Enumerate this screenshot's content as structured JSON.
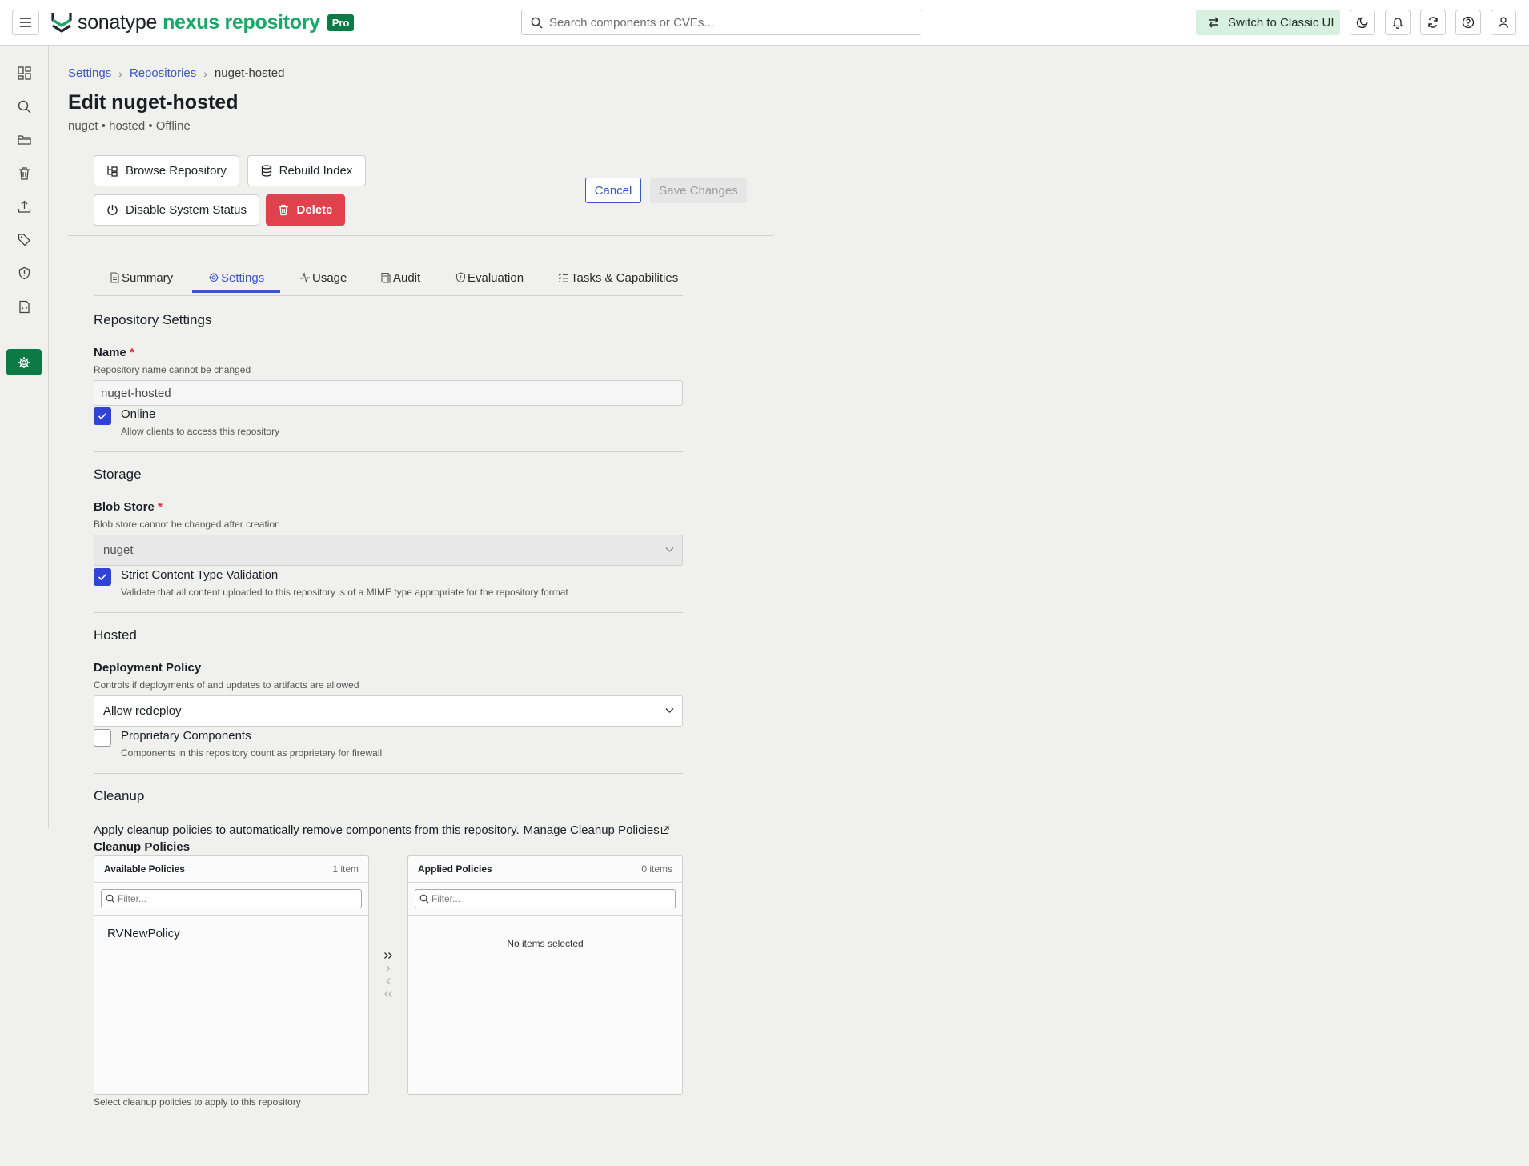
{
  "app": {
    "brand_primary": "sonatype",
    "brand_secondary": "nexus repository",
    "edition": "Pro",
    "colors": {
      "brand_green": "#0d7a45",
      "link_blue": "#3a56c8",
      "danger": "#e0414c",
      "checkbox": "#3142d6"
    }
  },
  "topbar": {
    "menu_icon": "hamburger-icon",
    "search_placeholder": "Search components or CVEs...",
    "classic_ui_label": "Switch to Classic UI",
    "icons": [
      "theme-toggle-icon",
      "bell-icon",
      "refresh-icon",
      "help-icon",
      "user-icon"
    ]
  },
  "sidenav": {
    "icons": [
      "dashboard-icon",
      "search-icon",
      "folder-icon",
      "trash-icon",
      "upload-icon",
      "tag-icon",
      "shield-icon",
      "report-icon"
    ],
    "active_icon": "settings-gear-icon"
  },
  "breadcrumb": {
    "items": [
      "Settings",
      "Repositories"
    ],
    "current": "nuget-hosted"
  },
  "page": {
    "title": "Edit nuget-hosted",
    "subtitle": "nuget • hosted • Offline"
  },
  "actions": {
    "browse": "Browse Repository",
    "rebuild": "Rebuild Index",
    "disable": "Disable System Status",
    "delete": "Delete",
    "cancel": "Cancel",
    "save": "Save Changes"
  },
  "tabs": [
    {
      "label": "Summary",
      "active": false
    },
    {
      "label": "Settings",
      "active": true
    },
    {
      "label": "Usage",
      "active": false
    },
    {
      "label": "Audit",
      "active": false
    },
    {
      "label": "Evaluation",
      "active": false
    },
    {
      "label": "Tasks & Capabilities",
      "active": false
    }
  ],
  "repo_settings": {
    "section_title": "Repository Settings",
    "name_label": "Name",
    "required_mark": "*",
    "name_help": "Repository name cannot be changed",
    "name_value": "nuget-hosted",
    "online_label": "Online",
    "online_help": "Allow clients to access this repository",
    "online_checked": true
  },
  "storage": {
    "section_title": "Storage",
    "blob_label": "Blob Store",
    "blob_help": "Blob store cannot be changed after creation",
    "blob_value": "nuget",
    "strict_label": "Strict Content Type Validation",
    "strict_help": "Validate that all content uploaded to this repository is of a MIME type appropriate for the repository format",
    "strict_checked": true
  },
  "hosted": {
    "section_title": "Hosted",
    "policy_label": "Deployment Policy",
    "policy_help": "Controls if deployments of and updates to artifacts are allowed",
    "policy_value": "Allow redeploy",
    "proprietary_label": "Proprietary Components",
    "proprietary_help": "Components in this repository count as proprietary for firewall",
    "proprietary_checked": false
  },
  "cleanup": {
    "section_title": "Cleanup",
    "description": "Apply cleanup policies to automatically remove components from this repository.",
    "manage_link": "Manage Cleanup Policies",
    "policies_label": "Cleanup Policies",
    "available": {
      "title": "Available Policies",
      "count": "1 item",
      "filter_placeholder": "Filter...",
      "items": [
        "RVNewPolicy"
      ]
    },
    "applied": {
      "title": "Applied Policies",
      "count": "0 items",
      "filter_placeholder": "Filter...",
      "empty_text": "No items selected"
    },
    "help": "Select cleanup policies to apply to this repository"
  }
}
